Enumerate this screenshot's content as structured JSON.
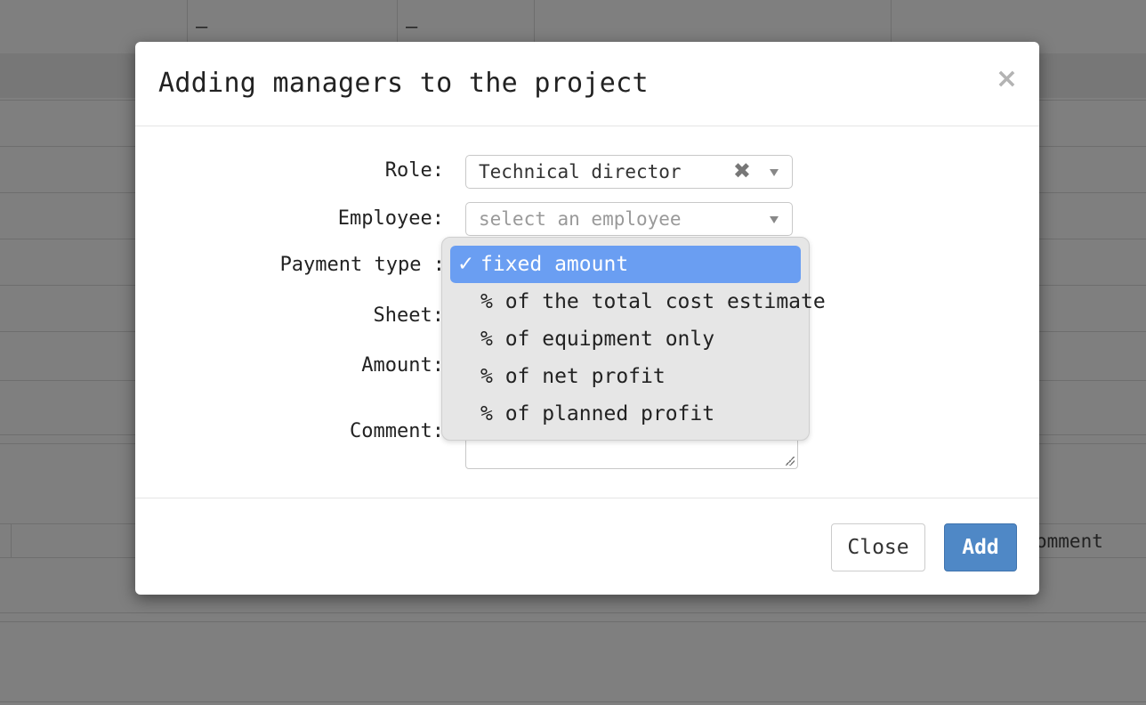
{
  "background": {
    "dash_1": "–",
    "dash_2": "–",
    "partial_header": "omment"
  },
  "modal": {
    "title": "Adding managers to the project",
    "close_icon": "×",
    "fields": {
      "role_label": "Role:",
      "role_value": "Technical director",
      "role_clear": "✖",
      "employee_label": "Employee:",
      "employee_placeholder": "select an employee",
      "payment_type_label": "Payment type :",
      "sheet_label": "Sheet:",
      "amount_label": "Amount:",
      "comment_label": "Comment:"
    },
    "footer": {
      "close_label": "Close",
      "add_label": "Add"
    }
  },
  "payment_dropdown": {
    "check_mark": "✓",
    "selected_index": 0,
    "options": [
      "fixed amount",
      "% of the total cost estimate",
      "% of equipment only",
      "% of net profit",
      "% of planned profit"
    ]
  },
  "colors": {
    "primary": "#4f88c6",
    "selected_option": "#6a9ef2",
    "overlay": "#7f7f7f"
  }
}
